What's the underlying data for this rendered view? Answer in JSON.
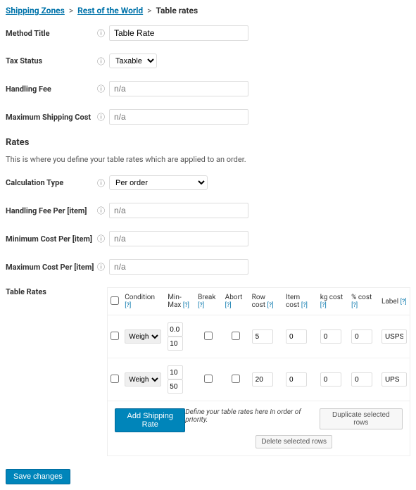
{
  "breadcrumb": {
    "shipping_zones": "Shipping Zones",
    "rest_of_world": "Rest of the World",
    "current": "Table rates"
  },
  "fields": {
    "method_title": {
      "label": "Method Title",
      "value": "Table Rate"
    },
    "tax_status": {
      "label": "Tax Status",
      "value": "Taxable"
    },
    "handling_fee": {
      "label": "Handling Fee",
      "placeholder": "n/a"
    },
    "max_shipping_cost": {
      "label": "Maximum Shipping Cost",
      "placeholder": "n/a"
    }
  },
  "rates_section": {
    "heading": "Rates",
    "desc": "This is where you define your table rates which are applied to an order.",
    "calculation_type": {
      "label": "Calculation Type",
      "value": "Per order"
    },
    "handling_fee_per": {
      "label": "Handling Fee Per [item]",
      "placeholder": "n/a"
    },
    "min_cost_per": {
      "label": "Minimum Cost Per [item]",
      "placeholder": "n/a"
    },
    "max_cost_per": {
      "label": "Maximum Cost Per [item]",
      "placeholder": "n/a"
    }
  },
  "table": {
    "label": "Table Rates",
    "headers": {
      "condition": "Condition",
      "minmax": "Min-Max",
      "break": "Break",
      "abort": "Abort",
      "rowcost": "Row cost",
      "itemcost": "Item cost",
      "kgcost": "kg cost",
      "pctcost": "% cost",
      "label": "Label"
    },
    "help": "[?]",
    "rows": [
      {
        "condition": "Weight",
        "min": "0.0",
        "max": "10",
        "break": false,
        "abort": false,
        "rowcost": "5",
        "itemcost": "0",
        "kgcost": "0",
        "pctcost": "0",
        "label": "USPS"
      },
      {
        "condition": "Weight",
        "min": "10",
        "max": "50",
        "break": false,
        "abort": false,
        "rowcost": "20",
        "itemcost": "0",
        "kgcost": "0",
        "pctcost": "0",
        "label": "UPS"
      }
    ],
    "footer": {
      "add": "Add Shipping Rate",
      "define": "Define your table rates here in order of priority.",
      "duplicate": "Duplicate selected rows",
      "delete": "Delete selected rows"
    }
  },
  "save": "Save changes"
}
